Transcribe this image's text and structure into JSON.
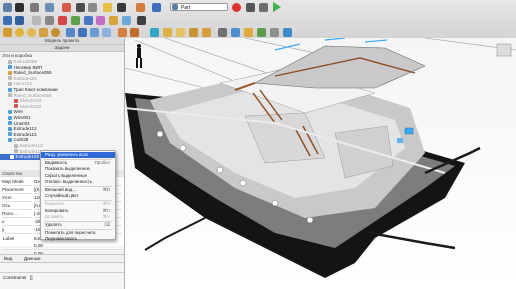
{
  "toolbar": {
    "document_name": "Part"
  },
  "panel": {
    "tab_model": "Модель проекта",
    "tab_tasks": "Задачи",
    "tree_header": "Эти и коробка"
  },
  "tree": [
    {
      "label": "Extrude098",
      "gray": true,
      "indent": 8,
      "color": "#b8b8b8"
    },
    {
      "label": "Несквер ВИП",
      "gray": false,
      "indent": 8,
      "color": "#4aa0d8"
    },
    {
      "label": "Ruled_Surface055",
      "gray": false,
      "indent": 8,
      "color": "#d4a13a"
    },
    {
      "label": "Extrude101",
      "gray": true,
      "indent": 8,
      "color": "#b8b8b8"
    },
    {
      "label": "Hacn104",
      "gray": true,
      "indent": 8,
      "color": "#b8b8b8"
    },
    {
      "label": "Трап Кают-компании",
      "gray": false,
      "indent": 8,
      "color": "#4aa0d8"
    },
    {
      "label": "Ruled_Surface056",
      "gray": true,
      "indent": 8,
      "color": "#b8b8b8"
    },
    {
      "label": "Sketch183",
      "gray": true,
      "indent": 14,
      "color": "#d85050"
    },
    {
      "label": "Sketch182",
      "gray": true,
      "indent": 14,
      "color": "#d85050"
    },
    {
      "label": "Wire",
      "gray": false,
      "indent": 8,
      "color": "#4aa0d8"
    },
    {
      "label": "Wire001",
      "gray": false,
      "indent": 8,
      "color": "#4aa0d8"
    },
    {
      "label": "Line001",
      "gray": false,
      "indent": 8,
      "color": "#4aa0d8"
    },
    {
      "label": "Extrude112",
      "gray": false,
      "indent": 8,
      "color": "#4aa0d8"
    },
    {
      "label": "Extrude114",
      "gray": false,
      "indent": 8,
      "color": "#4aa0d8"
    },
    {
      "label": "Cut028",
      "gray": false,
      "indent": 8,
      "color": "#4aa0d8"
    },
    {
      "label": "Extrude113",
      "gray": true,
      "indent": 14,
      "color": "#b8b8b8"
    },
    {
      "label": "Extrude115",
      "gray": true,
      "indent": 14,
      "color": "#b8b8b8"
    }
  ],
  "tree_selected": "Extrude109",
  "properties": {
    "tab_view": "Вид",
    "tab_data": "Данные",
    "section": "Свойства",
    "rows": [
      {
        "name": "Map Mode",
        "value": "Deact"
      },
      {
        "name": "Placement",
        "value": "[(0,00..."
      },
      {
        "name": "Угол",
        "value": "120,00"
      },
      {
        "name": "Ось",
        "value": "[0,00"
      },
      {
        "name": "Поло...",
        "value": "[-2500"
      },
      {
        "name": "x",
        "value": "-2500"
      },
      {
        "name": "y",
        "value": "-1800"
      },
      {
        "name": "z",
        "value": "0,00 м"
      },
      {
        "name": "",
        "value": "0,00"
      },
      {
        "name": "",
        "value": "0,00"
      }
    ],
    "label_row": "Label",
    "label_value": "Extrude109"
  },
  "bottom": {
    "label": "Constraints",
    "value": "[]"
  },
  "context_menu": {
    "items": [
      {
        "label": "Разд. увеличить всех",
        "shortcut": "",
        "disabled": false,
        "highlight": true
      },
      {
        "label": "Видимость",
        "shortcut": "Пробел",
        "disabled": false,
        "highlight": false
      },
      {
        "label": "Показать выделенное",
        "shortcut": "",
        "disabled": false,
        "highlight": false
      },
      {
        "label": "Скрыть выделенные",
        "shortcut": "",
        "disabled": false,
        "highlight": false
      },
      {
        "label": "Отключ. выделенность",
        "shortcut": "",
        "disabled": false,
        "highlight": false
      },
      {
        "label": "Внешний вид...",
        "shortcut": "⌘D",
        "disabled": false,
        "highlight": false
      },
      {
        "label": "Случайный цвет",
        "shortcut": "",
        "disabled": false,
        "highlight": false
      },
      {
        "label": "Вырезать",
        "shortcut": "⌘X",
        "disabled": true,
        "highlight": false
      },
      {
        "label": "Копировать",
        "shortcut": "⌘C",
        "disabled": false,
        "highlight": false
      },
      {
        "label": "Вставить",
        "shortcut": "⌘V",
        "disabled": true,
        "highlight": false
      },
      {
        "label": "Удалить",
        "shortcut": "⌫",
        "disabled": false,
        "highlight": false
      },
      {
        "label": "Пометить для пересчета",
        "shortcut": "",
        "disabled": false,
        "highlight": false
      },
      {
        "label": "Переименовать",
        "shortcut": "",
        "disabled": false,
        "highlight": false
      }
    ]
  },
  "colors": {
    "selection": "#3f6fd1",
    "hull_dark": "#1a1a1a",
    "deck_gray": "#b8b8b8",
    "wood": "#9b5a2a",
    "edge_highlight": "#3aa8ff"
  }
}
